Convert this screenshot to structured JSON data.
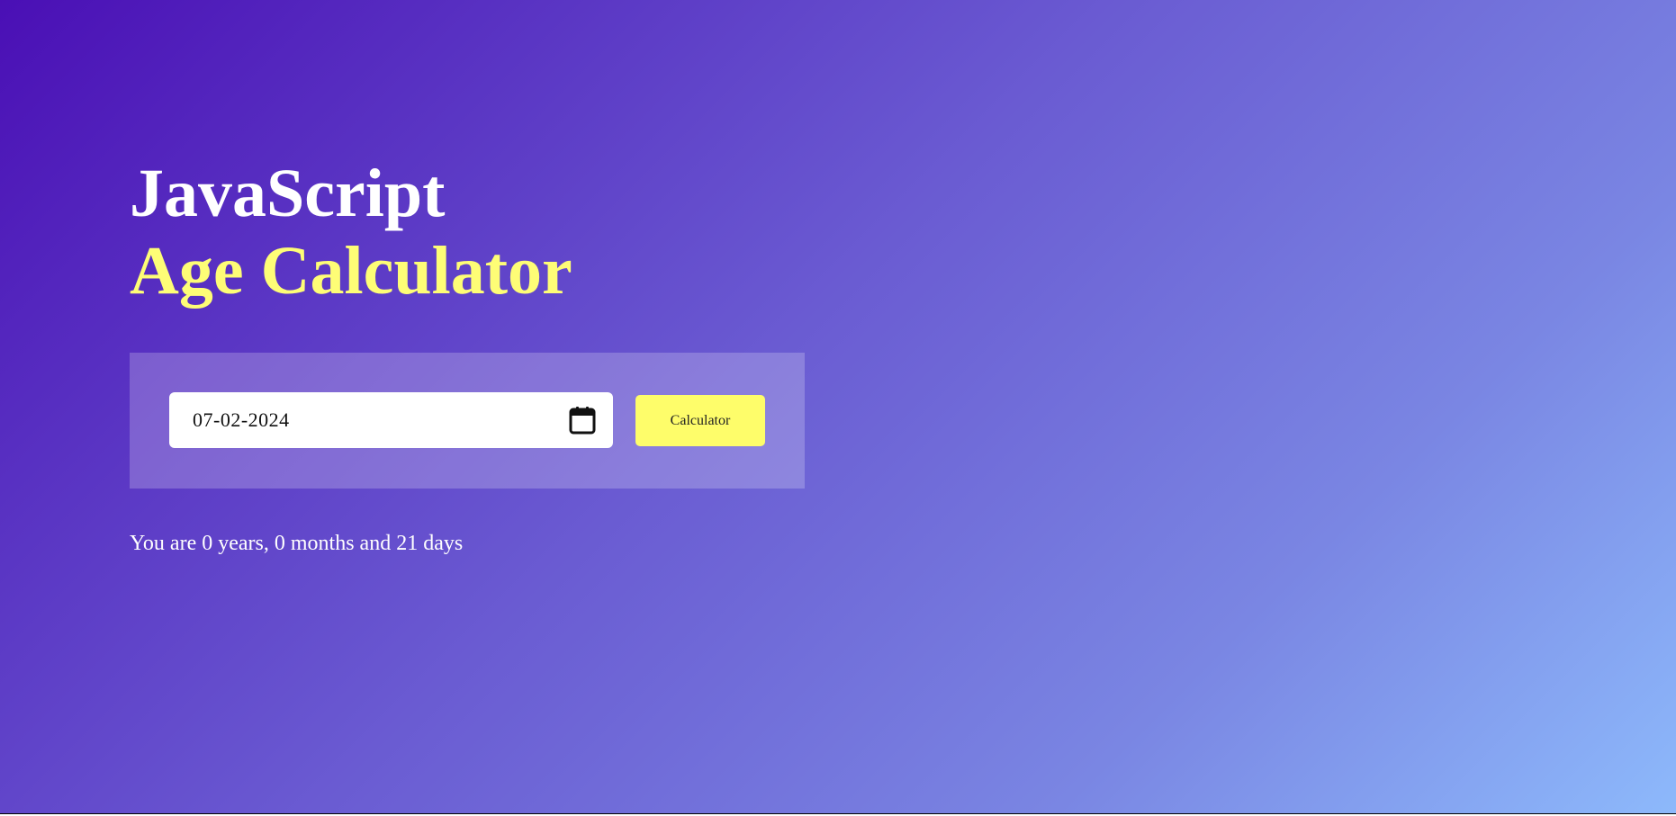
{
  "header": {
    "title_line1": "JavaScript",
    "title_line2": "Age Calculator"
  },
  "form": {
    "date_value": "07-02-2024",
    "calendar_icon": "calendar-icon",
    "button_label": "Calculator"
  },
  "result": {
    "text": "You are 0 years, 0 months and 21 days"
  },
  "colors": {
    "gradient_start": "#4a0fb5",
    "gradient_end": "#8db9fb",
    "accent_yellow": "#fefd76",
    "button_yellow": "#fefd6a",
    "text_white": "#ffffff"
  }
}
